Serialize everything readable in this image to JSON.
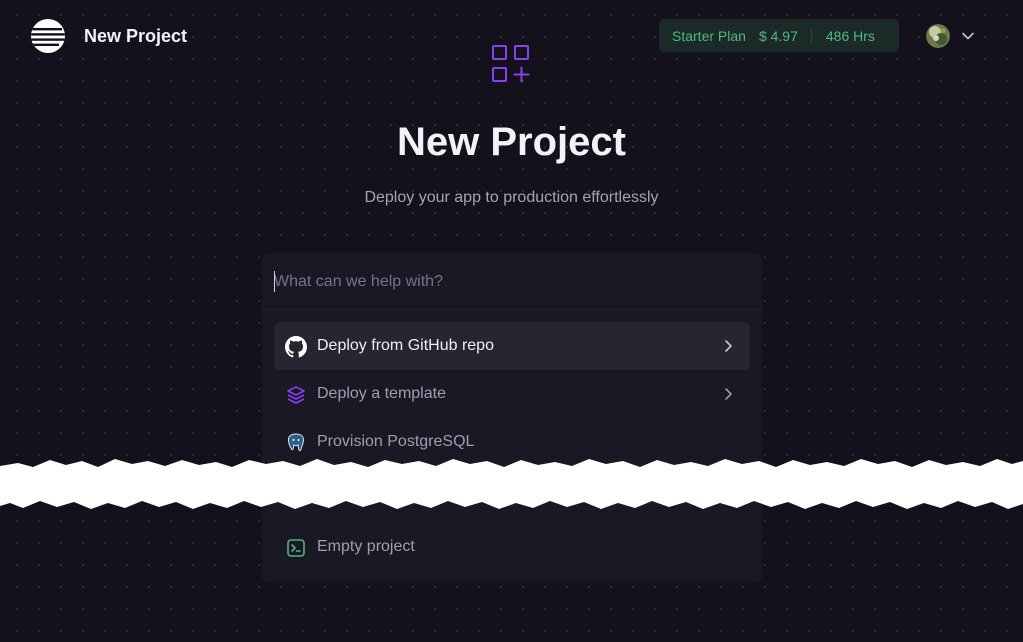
{
  "header": {
    "title": "New Project",
    "plan": {
      "name": "Starter Plan",
      "cost": "$ 4.97",
      "hours": "486 Hrs"
    }
  },
  "hero": {
    "icon": "grid-plus-icon",
    "title": "New Project",
    "subtitle": "Deploy your app to production effortlessly"
  },
  "search": {
    "placeholder": "What can we help with?",
    "value": ""
  },
  "options": [
    {
      "label": "Deploy from GitHub repo",
      "icon": "github-icon",
      "has_chevron": true,
      "active": true
    },
    {
      "label": "Deploy a template",
      "icon": "layers-icon",
      "has_chevron": true,
      "active": false
    },
    {
      "label": "Provision PostgreSQL",
      "icon": "postgresql-icon",
      "has_chevron": false,
      "active": false
    },
    {
      "label": "Empty project",
      "icon": "terminal-icon",
      "has_chevron": false,
      "active": false
    }
  ],
  "colors": {
    "background": "#13111c",
    "panel": "#191824",
    "accent_purple": "#8a3ff0",
    "plan_green": "#4fb87f"
  }
}
